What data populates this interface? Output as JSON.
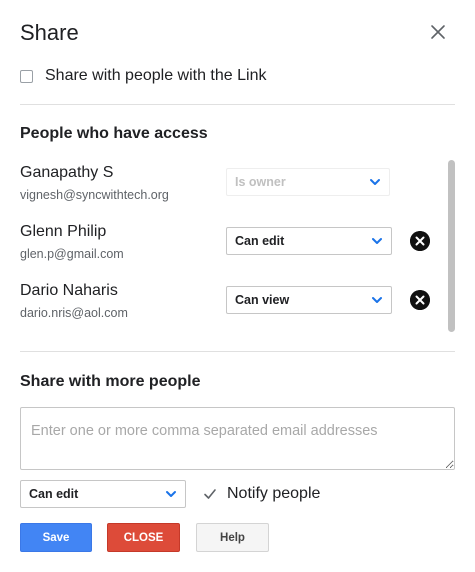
{
  "dialog": {
    "title": "Share",
    "close_icon": "close-icon"
  },
  "link_share": {
    "label": "Share with people with the Link",
    "checked": false
  },
  "access": {
    "heading": "People who have access",
    "people": [
      {
        "name": "Ganapathy S",
        "email": "vignesh@syncwithtech.org",
        "role": "Is owner",
        "role_disabled": true,
        "removable": false
      },
      {
        "name": "Glenn Philip",
        "email": "glen.p@gmail.com",
        "role": "Can edit",
        "role_disabled": false,
        "removable": true
      },
      {
        "name": "Dario Naharis",
        "email": "dario.nris@aol.com",
        "role": "Can view",
        "role_disabled": false,
        "removable": true
      }
    ]
  },
  "share_more": {
    "heading": "Share with more people",
    "emails_placeholder": "Enter one or more comma separated email addresses",
    "emails_value": "",
    "permission": "Can edit",
    "notify_label": "Notify people",
    "notify_checked": true
  },
  "buttons": {
    "save": "Save",
    "close": "CLOSE",
    "help": "Help"
  },
  "colors": {
    "accent_blue": "#4285f4",
    "danger_red": "#dd4b39",
    "chevron_blue": "#1a73e8"
  }
}
